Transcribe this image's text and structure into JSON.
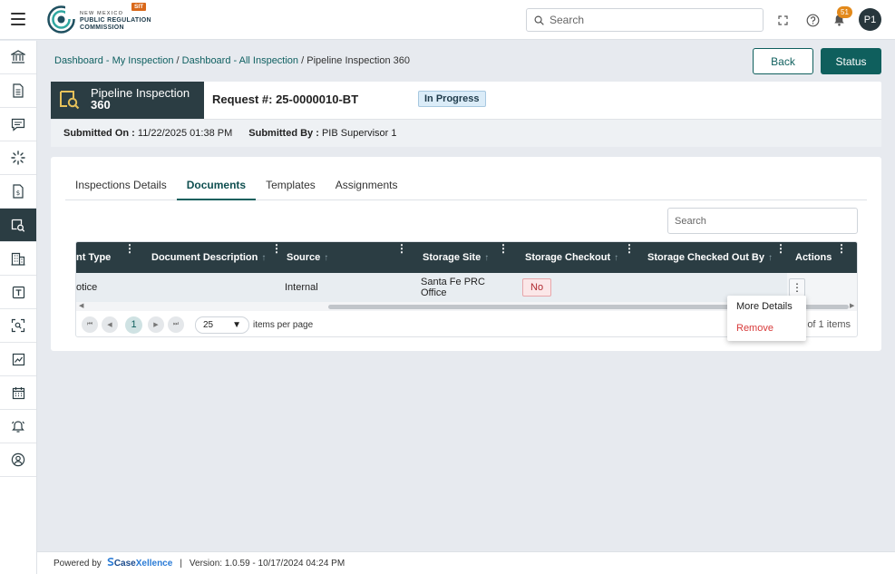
{
  "header": {
    "logo_line1": "NEW MEXICO",
    "logo_line2": "PUBLIC REGULATION",
    "logo_line3": "COMMISSION",
    "env_badge": "SIT",
    "search_placeholder": "Search",
    "notification_count": "51",
    "avatar_initials": "P1"
  },
  "sidebar": {
    "items": [
      "bank-icon",
      "document-icon",
      "chat-icon",
      "spinner-icon",
      "invoice-icon",
      "inspection-icon",
      "building-icon",
      "template-icon",
      "scan-icon",
      "chart-icon",
      "calendar-icon",
      "alarm-icon",
      "user-circle-icon"
    ],
    "active_index": 5
  },
  "breadcrumb": {
    "items": [
      "Dashboard - My Inspection",
      "Dashboard - All Inspection"
    ],
    "separator": "/",
    "current": "Pipeline Inspection 360"
  },
  "actions": {
    "back": "Back",
    "status": "Status"
  },
  "title": {
    "line1": "Pipeline Inspection",
    "line2": "360",
    "request": "Request #: 25-0000010-BT",
    "status": "In Progress",
    "submitted_on_label": "Submitted On :",
    "submitted_on_value": "11/22/2025 01:38 PM",
    "submitted_by_label": "Submitted By :",
    "submitted_by_value": "PIB Supervisor 1"
  },
  "tabs": [
    "Inspections Details",
    "Documents",
    "Templates",
    "Assignments"
  ],
  "active_tab": 1,
  "table": {
    "search_placeholder": "Search",
    "columns": [
      "nt Type",
      "Document Description",
      "Source",
      "Storage Site",
      "Storage Checkout",
      "Storage Checked Out By",
      "Actions"
    ],
    "rows": [
      {
        "type": "otice",
        "description": "",
        "source": "Internal",
        "site_line1": "Santa Fe PRC",
        "site_line2": "Office",
        "checkout": "No",
        "checked_out_by": ""
      }
    ],
    "pager": {
      "page": "1",
      "page_size": "25",
      "items_per_page": "items per page",
      "count": "of 1 items"
    }
  },
  "row_menu": {
    "more_details": "More Details",
    "remove": "Remove"
  },
  "footer": {
    "powered_by": "Powered by",
    "brand_a": "Case",
    "brand_b": "Xellence",
    "separator": "|",
    "version": "Version: 1.0.59 - 10/17/2024 04:24 PM"
  },
  "colors": {
    "primary": "#0f5f5d",
    "dark": "#2b3d43",
    "badge": "#e3891a",
    "danger": "#d83a3a"
  }
}
